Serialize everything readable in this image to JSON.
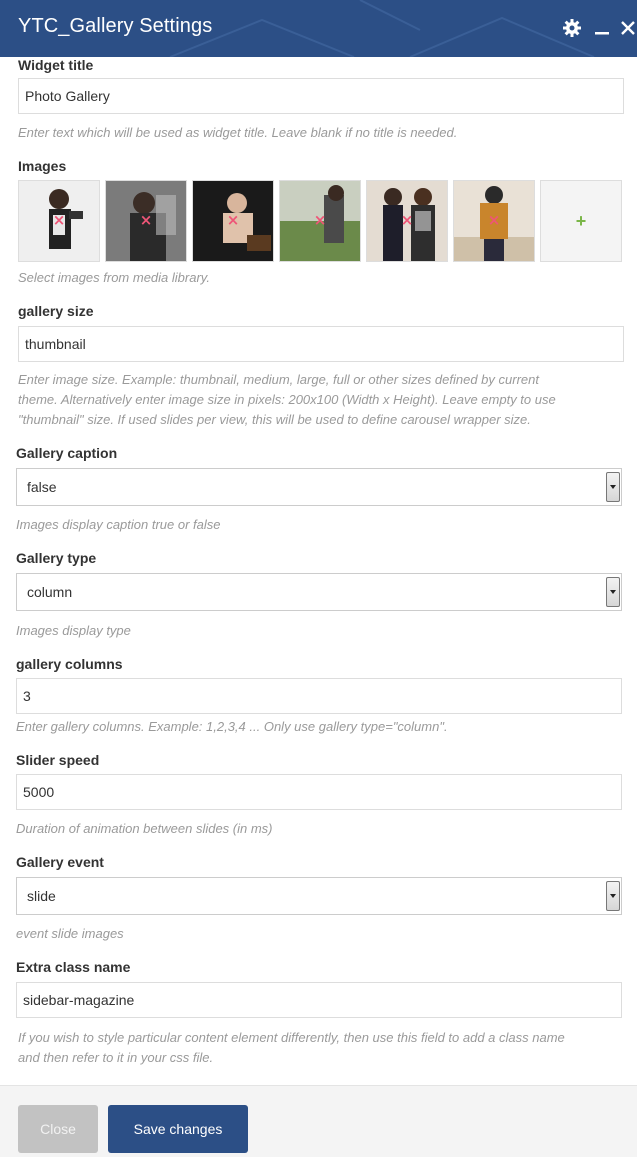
{
  "window": {
    "title": "YTC_Gallery Settings"
  },
  "fields": {
    "widget_title": {
      "label": "Widget title",
      "value": "Photo Gallery",
      "help": "Enter text which will be used as widget title. Leave blank if no title is needed."
    },
    "images": {
      "label": "Images",
      "help": "Select images from media library.",
      "remove_glyph": "×",
      "add_glyph": "+"
    },
    "gallery_size": {
      "label": "gallery size",
      "value": "thumbnail",
      "help_lines": [
        "Enter image size. Example: thumbnail, medium, large, full or other sizes defined by current",
        "theme. Alternatively enter image size in pixels: 200x100 (Width x Height). Leave empty to use",
        "\"thumbnail\" size. If used slides per view, this will be used to define carousel wrapper size."
      ]
    },
    "gallery_caption": {
      "label": "Gallery caption",
      "value": "false",
      "help": "Images display caption true or false"
    },
    "gallery_type": {
      "label": "Gallery type",
      "value": "column",
      "help": "Images display type"
    },
    "gallery_columns": {
      "label": "gallery columns",
      "value": "3",
      "help": "Enter gallery columns. Example: 1,2,3,4 ... Only use gallery type=\"column\"."
    },
    "slider_speed": {
      "label": "Slider speed",
      "value": "5000",
      "help": "Duration of animation between slides (in ms)"
    },
    "gallery_event": {
      "label": "Gallery event",
      "value": "slide",
      "help": "event slide images"
    },
    "extra_class": {
      "label": "Extra class name",
      "value": "sidebar-magazine",
      "help_lines": [
        "If you wish to style particular content element differently, then use this field to add a class name",
        "and then refer to it in your css file."
      ]
    }
  },
  "footer": {
    "close_label": "Close",
    "save_label": "Save changes"
  },
  "colors": {
    "header": "#2c4f86",
    "primary_button": "#2c4f86",
    "close_button": "#c2c2c2",
    "add_plus": "#7ab648",
    "remove_x": "#ee5577"
  },
  "icons": [
    "gear-icon",
    "minimize-icon",
    "close-icon",
    "remove-image-icon",
    "add-image-icon",
    "select-arrow-icon"
  ]
}
